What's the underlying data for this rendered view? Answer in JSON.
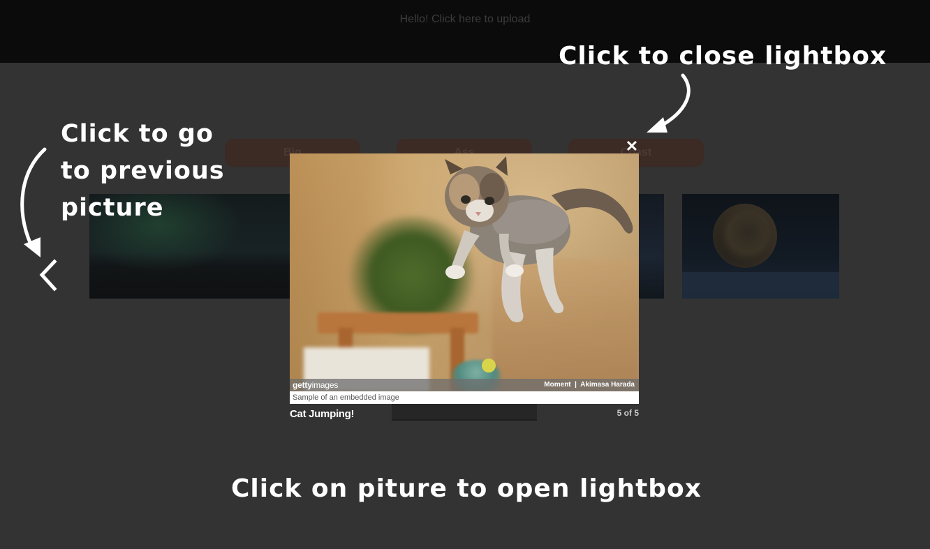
{
  "header": {
    "upload_text": "Hello! Click here to upload"
  },
  "categories": [
    {
      "label": "Big"
    },
    {
      "label": "Ass"
    },
    {
      "label": "Coast"
    }
  ],
  "lightbox": {
    "credit": {
      "brand_bold": "getty",
      "brand_light": "images",
      "attribution": "Moment  |  Akimasa Harada"
    },
    "embed_caption": "Sample of an embedded image",
    "title": "Cat Jumping!",
    "counter": "5 of 5",
    "close_glyph": "✕",
    "icons": {
      "close": "close-icon",
      "previous": "chevron-left-icon"
    }
  },
  "annotations": {
    "close_hint": "Click to close lightbox",
    "prev_hint": "Click to go to previous picture",
    "open_hint": "Click on piture to open lightbox"
  },
  "colors": {
    "background": "#333333",
    "header": "#0b0b0b",
    "annotation": "#ffffff"
  }
}
